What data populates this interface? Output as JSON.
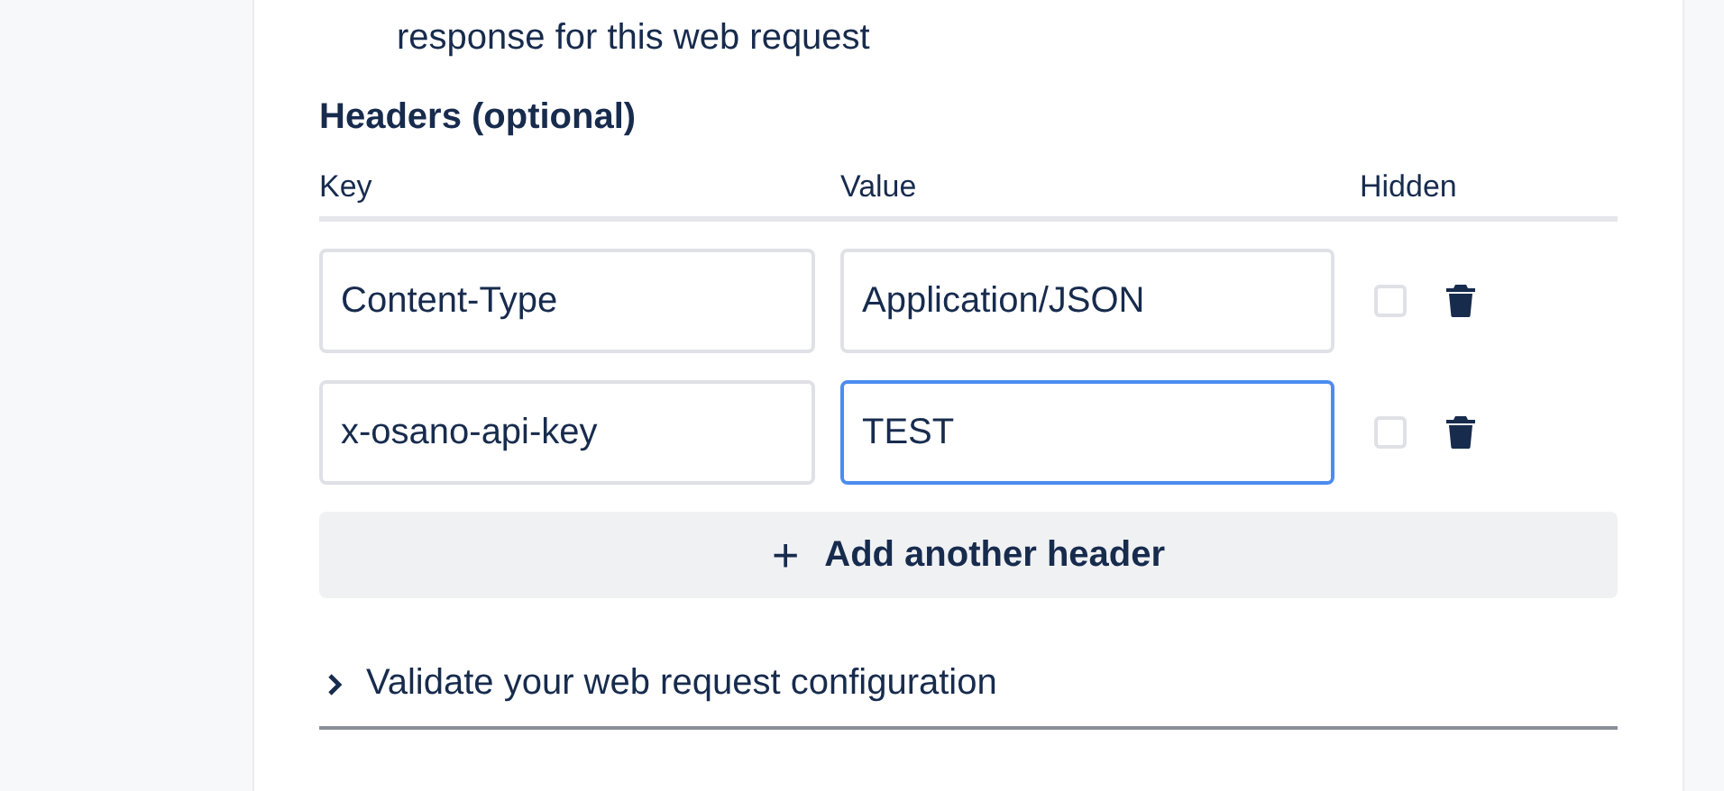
{
  "description_tail": "response for this web request",
  "headers": {
    "title": "Headers (optional)",
    "columns": [
      "Key",
      "Value",
      "Hidden"
    ],
    "rows": [
      {
        "key": "Content-Type",
        "value": "Application/JSON",
        "hidden": false,
        "focused": false
      },
      {
        "key": "x-osano-api-key",
        "value": "TEST",
        "hidden": false,
        "focused": true
      }
    ],
    "add_button": {
      "icon": "+",
      "label": "Add another header"
    }
  },
  "validate": {
    "label": "Validate your web request configuration",
    "expanded": false
  }
}
